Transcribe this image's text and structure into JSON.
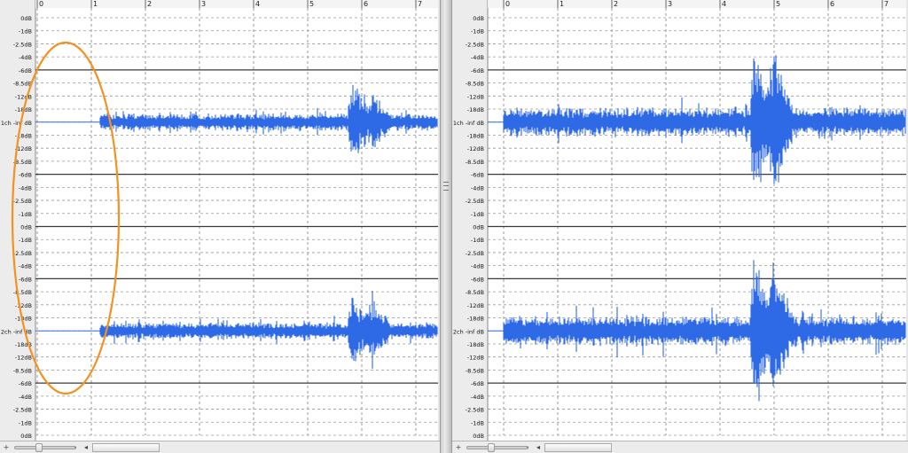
{
  "colors": {
    "waveform": "#2f6ae6",
    "annotation": "#f39121",
    "background": "#ffffff",
    "grid_major": "#3a3a3a",
    "grid_minor": "#9a9a9a"
  },
  "ruler": {
    "ticks": [
      "0",
      "1",
      "2",
      "3",
      "4",
      "5",
      "6",
      "7"
    ]
  },
  "left_panel": {
    "db_labels": [
      "0dB",
      "-1dB",
      "-2.5dB",
      "-4dB",
      "-6dB",
      "-8.5dB",
      "-12dB",
      "-18dB",
      "1ch -inf dB",
      "-18dB",
      "-12dB",
      "-8.5dB",
      "-6dB",
      "-4dB",
      "-2.5dB",
      "-1dB",
      "0dB",
      "-1dB",
      "-2.5dB",
      "-4dB",
      "-6dB",
      "-8.5dB",
      "-12dB",
      "-18dB",
      "2ch -inf dB",
      "-18dB",
      "-12dB",
      "-8.5dB",
      "-6dB",
      "-4dB",
      "-2.5dB",
      "-1dB",
      "0dB"
    ],
    "annotation": "orange ellipse highlighting silent lead-in"
  },
  "right_panel": {
    "db_labels": [
      "0dB",
      "-1dB",
      "-2.5dB",
      "-4dB",
      "-6dB",
      "-8.5dB",
      "-12dB",
      "-18dB",
      "1ch -inf dB",
      "-18dB",
      "-12dB",
      "-8.5dB",
      "-6dB",
      "-4dB",
      "-2.5dB",
      "-1dB",
      "0dB",
      "-1dB",
      "-2.5dB",
      "-4dB",
      "-6dB",
      "-8.5dB",
      "-12dB",
      "-18dB",
      "2ch -inf dB",
      "-18dB",
      "-12dB",
      "-8.5dB",
      "-6dB",
      "-4dB",
      "-2.5dB",
      "-1dB",
      "0dB"
    ]
  },
  "scrollbar": {
    "left_arrow": "◂",
    "plus": "+",
    "minus": "-"
  }
}
